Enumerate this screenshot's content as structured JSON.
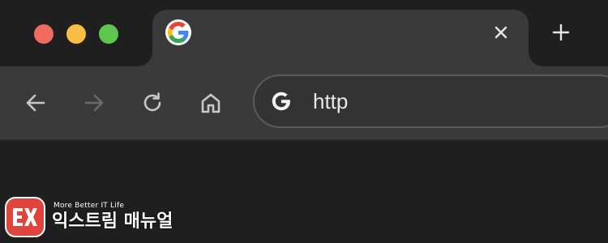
{
  "colors": {
    "traffic_close": "#ef6b5f",
    "traffic_minimize": "#f7bd44",
    "traffic_maximize": "#5ec84e",
    "tab_active": "#3a3a3a",
    "frame": "#1f1f1f",
    "icon": "#c8c8c8",
    "icon_disabled": "#6a6a6a",
    "watermark_red": "#e0443c"
  },
  "window": {
    "traffic_lights": [
      "close",
      "minimize",
      "maximize"
    ]
  },
  "tab": {
    "favicon": "google-g-icon",
    "title": "",
    "close_icon": "close-icon"
  },
  "tabstrip": {
    "new_tab_icon": "plus-icon"
  },
  "toolbar": {
    "buttons": [
      {
        "name": "back",
        "icon": "arrow-left-icon",
        "enabled": true
      },
      {
        "name": "forward",
        "icon": "arrow-right-icon",
        "enabled": false
      },
      {
        "name": "reload",
        "icon": "reload-icon",
        "enabled": true
      },
      {
        "name": "home",
        "icon": "home-icon",
        "enabled": true
      }
    ],
    "omnibox": {
      "icon": "google-g-icon",
      "value": "http"
    }
  },
  "watermark": {
    "tagline": "More Better IT Life",
    "name": "익스트림 매뉴얼"
  }
}
